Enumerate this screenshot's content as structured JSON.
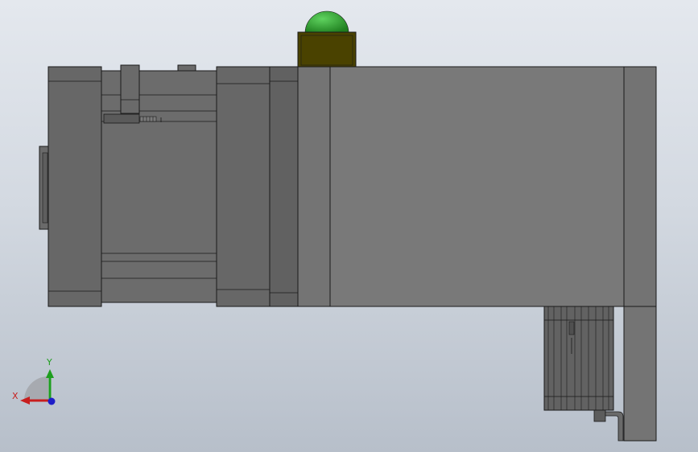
{
  "viewport": {
    "background_top": "#e4e8ee",
    "background_bottom": "#b7bfca"
  },
  "model": {
    "body_color": "#6e6e6e",
    "body_dark": "#5f5f5f",
    "body_light": "#7a7a7a",
    "edge_color": "#1a1a1a",
    "indicator_dome_color": "#2e9e2e",
    "indicator_base_color": "#4a4200"
  },
  "triad": {
    "x_label": "X",
    "y_label": "Y",
    "x_color": "#c81e1e",
    "y_color": "#1e9e1e",
    "z_color": "#1e1ec8"
  }
}
